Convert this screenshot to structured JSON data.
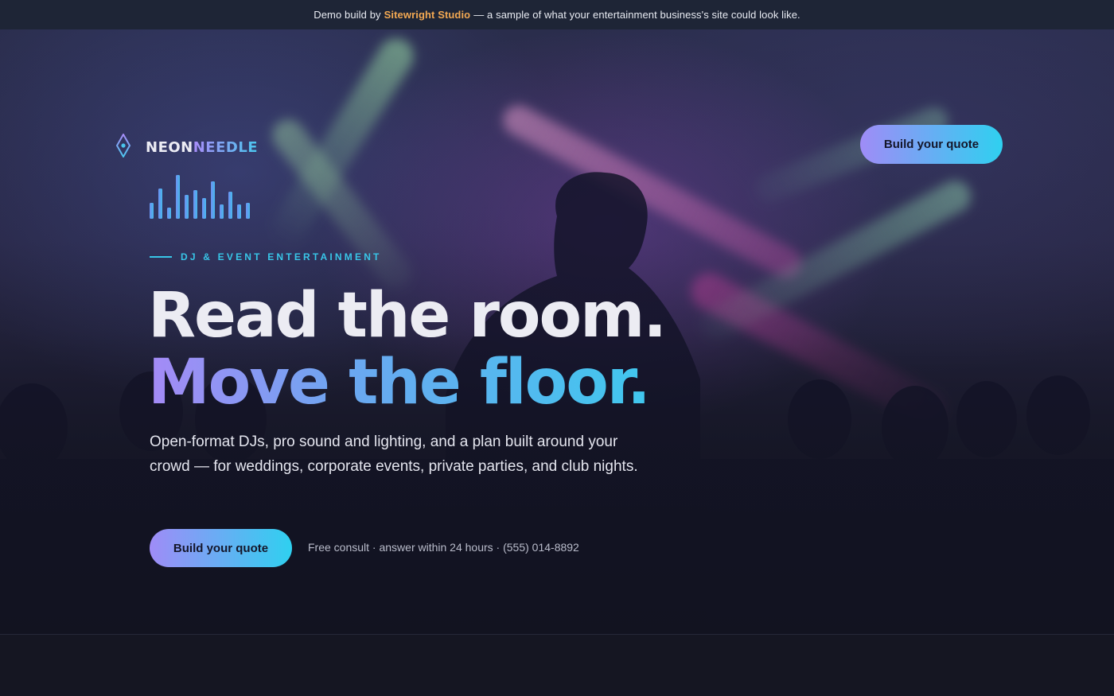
{
  "banner": {
    "prefix": "Demo build by",
    "studio": "Sitewright Studio",
    "suffix": "— a sample of what your entertainment business's site could look like."
  },
  "brand": {
    "name_part1": "NEON",
    "name_part2": "NEEDLE",
    "icon": "diamond-pin-icon"
  },
  "nav": {
    "cta_label": "Build your quote"
  },
  "hero": {
    "eyebrow": "DJ & EVENT ENTERTAINMENT",
    "headline_line1": "Read the room.",
    "headline_line2": "Move the floor.",
    "lead": "Open-format DJs, pro sound and lighting, and a plan built around your crowd — for weddings, corporate events, private parties, and club nights.",
    "cta_label": "Build your quote",
    "meta": "Free consult · answer within 24 hours · (555) 014-8892",
    "equalizer_icon": "equalizer-bars-icon"
  },
  "colors": {
    "accent_purple": "#a58af6",
    "accent_cyan": "#2fd0f0",
    "banner_highlight": "#f2a852",
    "background": "#141521"
  }
}
